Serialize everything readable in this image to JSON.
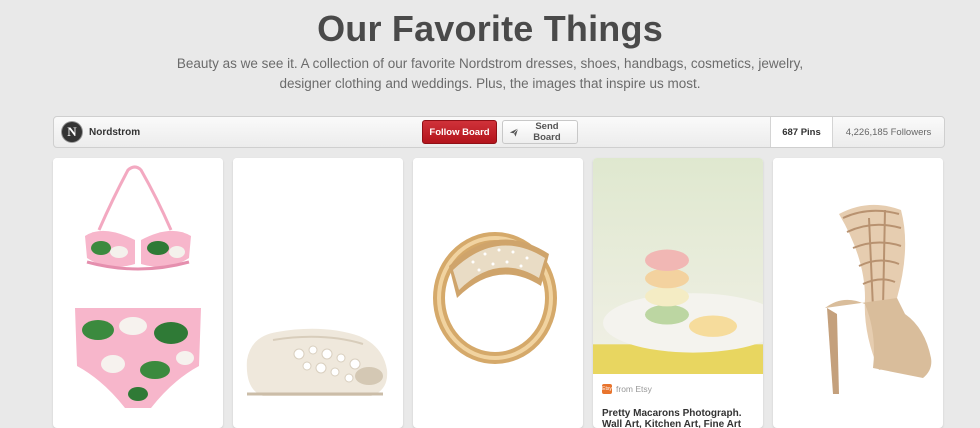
{
  "board": {
    "title": "Our Favorite Things",
    "description": "Beauty as we see it. A collection of our favorite Nordstrom dresses, shoes, handbags, cosmetics, jewelry, designer clothing and weddings. Plus, the images that inspire us most."
  },
  "boardbar": {
    "owner_avatar_letter": "N",
    "owner_name": "Nordstrom",
    "follow_label": "Follow Board",
    "send_label": "Send Board",
    "pins_count": "687 Pins",
    "followers_count": "4,226,185 Followers"
  },
  "pins": [
    {
      "image": "floral-bikini"
    },
    {
      "image": "white-lace-flat"
    },
    {
      "image": "gold-crystal-ring"
    },
    {
      "image": "macarons-photo",
      "source": "from Etsy",
      "description": "Pretty Macarons Photograph. Wall Art, Kitchen Art, Fine Art"
    },
    {
      "image": "beige-caged-heel"
    }
  ],
  "colors": {
    "background": "#e9e9e9",
    "follow_button": "#c8202a",
    "etsy": "#e8742d"
  }
}
